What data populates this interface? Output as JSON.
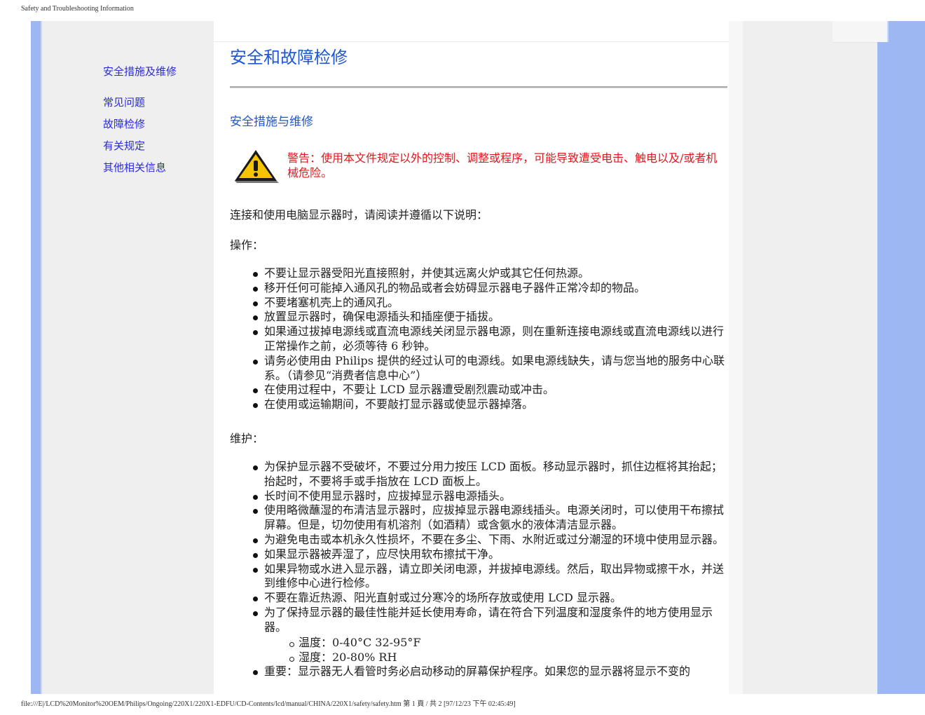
{
  "print_header": "Safety and Troubleshooting Information",
  "print_footer": "file:///E|/LCD%20Monitor%20OEM/Philips/Ongoing/220X1/220X1-EDFU/CD-Contents/lcd/manual/CHINA/220X1/safety/safety.htm 第 1 頁 / 共 2  [97/12/23 下午 02:45:49]",
  "sidebar": {
    "items": [
      {
        "label": "安全措施及维修"
      },
      {
        "label": "常见问题"
      },
      {
        "label": "故障检修"
      },
      {
        "label": "有关规定"
      },
      {
        "label": "其他相关信息"
      }
    ]
  },
  "main": {
    "title": "安全和故障检修",
    "section_title": "安全措施与维修",
    "warning": "警告：使用本文件规定以外的控制、调整或程序，可能导致遭受电击、触电以及/或者机械危险。",
    "intro": "连接和使用电脑显示器时，请阅读并遵循以下说明：",
    "operation": {
      "heading": "操作：",
      "items": [
        "不要让显示器受阳光直接照射，并使其远离火炉或其它任何热源。",
        "移开任何可能掉入通风孔的物品或者会妨碍显示器电子器件正常冷却的物品。",
        "不要堵塞机壳上的通风孔。",
        "放置显示器时，确保电源插头和插座便于插拔。",
        "如果通过拔掉电源线或直流电源线关闭显示器电源，则在重新连接电源线或直流电源线以进行正常操作之前，必须等待 6 秒钟。",
        "请务必使用由 Philips 提供的经过认可的电源线。如果电源线缺失，请与您当地的服务中心联系。（请参见“消费者信息中心”）",
        "在使用过程中，不要让 LCD 显示器遭受剧烈震动或冲击。",
        "在使用或运输期间，不要敲打显示器或使显示器掉落。"
      ]
    },
    "maintenance": {
      "heading": "维护：",
      "items": [
        "为保护显示器不受破坏，不要过分用力按压 LCD 面板。移动显示器时，抓住边框将其抬起；抬起时，不要将手或手指放在 LCD 面板上。",
        "长时间不使用显示器时，应拔掉显示器电源插头。",
        "使用略微蘸湿的布清洁显示器时，应拔掉显示器电源线插头。电源关闭时，可以使用干布擦拭屏幕。但是，切勿使用有机溶剂（如酒精）或含氨水的液体清洁显示器。",
        "为避免电击或本机永久性损坏，不要在多尘、下雨、水附近或过分潮湿的环境中使用显示器。",
        "如果显示器被弄湿了，应尽快用软布擦拭干净。",
        "如果异物或水进入显示器，请立即关闭电源，并拔掉电源线。然后，取出异物或擦干水，并送到维修中心进行检修。",
        "不要在靠近热源、阳光直射或过分寒冷的场所存放或使用 LCD 显示器。",
        "为了保持显示器的最佳性能并延长使用寿命，请在符合下列温度和湿度条件的地方使用显示器。"
      ],
      "sub_items": [
        "温度：0-40°C 32-95°F",
        "湿度：20-80% RH"
      ],
      "last_item": "重要：显示器无人看管时务必启动移动的屏幕保护程序。如果您的显示器将显示不变的"
    }
  },
  "colors": {
    "link": "#2b2bd9",
    "title": "#1f56d6",
    "warning": "#e0181d",
    "frame_blue": "#9db7f2",
    "sidebar_bg": "#efefef"
  },
  "icons": {
    "warning": "warning-triangle-icon"
  }
}
